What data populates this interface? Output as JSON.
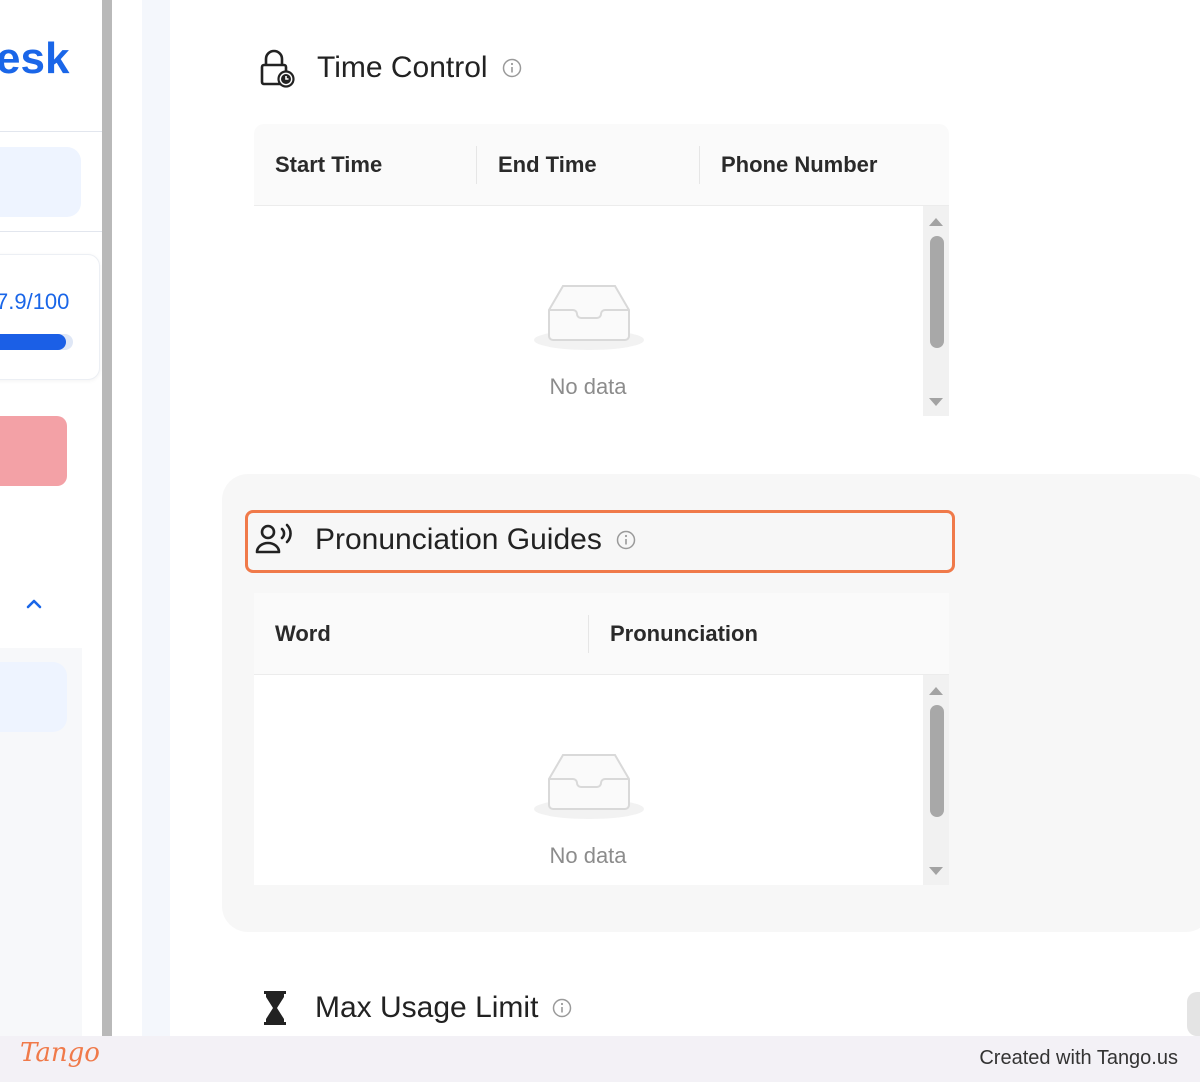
{
  "sidebar": {
    "logo_text": "esk",
    "usage": {
      "label": "7.9/100",
      "progress_fraction": 0.92
    }
  },
  "sections": {
    "time_control": {
      "title": "Time Control",
      "columns": [
        "Start Time",
        "End Time",
        "Phone Number"
      ],
      "empty_text": "No data"
    },
    "pronunciation_guides": {
      "title": "Pronunciation Guides",
      "columns": [
        "Word",
        "Pronunciation"
      ],
      "empty_text": "No data"
    },
    "max_usage_limit": {
      "title": "Max Usage Limit"
    }
  },
  "icons": {
    "time_control": "lock-clock-icon",
    "pronunciation_guides": "person-speaking-icon",
    "max_usage_limit": "hourglass-icon",
    "info": "info-icon",
    "empty": "empty-inbox-icon"
  },
  "colors": {
    "brand_blue": "#1a66e8",
    "highlight": "#f07a4a",
    "danger_pink": "#f3a1a6"
  },
  "footer": {
    "brand": "Tango",
    "credit": "Created with Tango.us"
  }
}
